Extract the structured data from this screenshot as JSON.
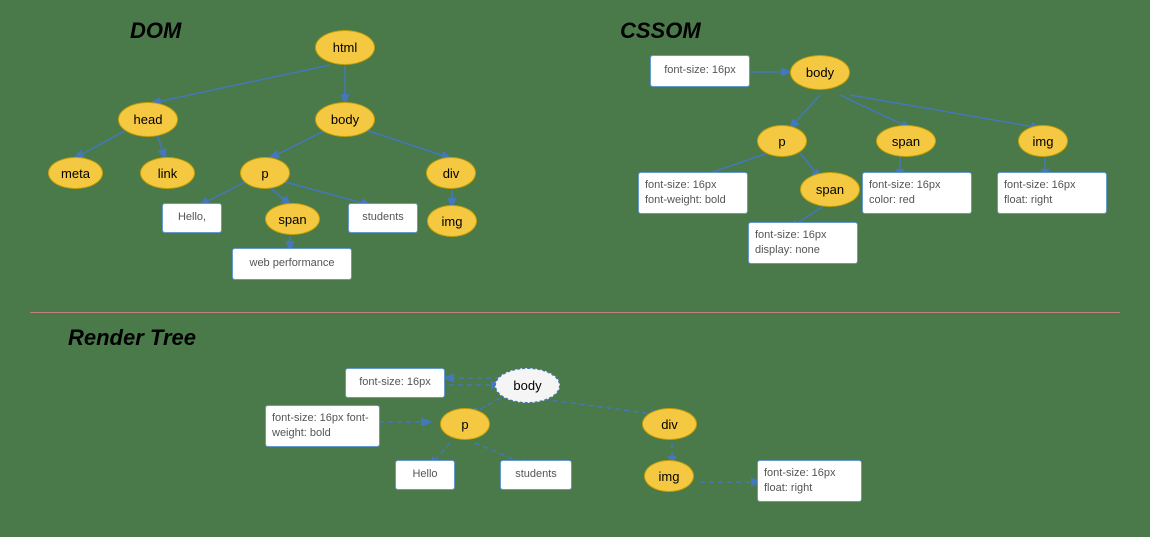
{
  "sections": {
    "dom": {
      "label": "DOM"
    },
    "cssom": {
      "label": "CSSOM"
    },
    "render_tree": {
      "label": "Render Tree"
    }
  },
  "dom_nodes": {
    "html": "html",
    "head": "head",
    "body": "body",
    "meta": "meta",
    "link": "link",
    "p": "p",
    "div": "div",
    "span": "span",
    "img": "img"
  },
  "dom_boxes": {
    "hello": "Hello,",
    "students": "students",
    "web_performance": "web performance"
  },
  "cssom_nodes": {
    "body": "body",
    "p": "p",
    "span1": "span",
    "img": "img",
    "span2": "span"
  },
  "cssom_boxes": {
    "root": "font-size: 16px",
    "p_style": "font-size: 16px\nfont-weight: bold",
    "span1_style": "font-size: 16px\ncolor: red",
    "img_style": "font-size: 16px\nfloat: right",
    "span2_style": "font-size: 16px\ndisplay: none"
  },
  "render_nodes": {
    "body": "body",
    "p": "p",
    "div": "div",
    "img": "img"
  },
  "render_boxes": {
    "root_style": "font-size: 16px",
    "p_style": "font-size: 16px\nfont-weight: bold",
    "hello": "Hello",
    "students": "students",
    "img_style": "font-size: 16px\nfloat: right"
  }
}
